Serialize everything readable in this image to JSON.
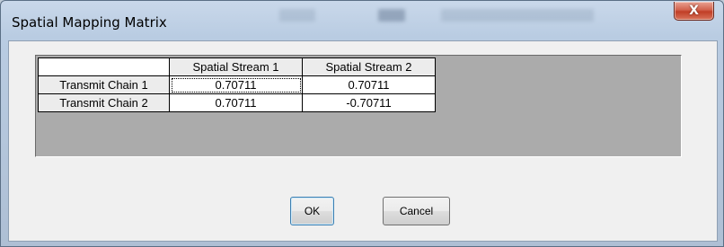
{
  "window": {
    "title": "Spatial Mapping Matrix",
    "close_label": "X"
  },
  "matrix": {
    "column_headers": [
      "Spatial Stream 1",
      "Spatial Stream 2"
    ],
    "rows": [
      {
        "label": "Transmit Chain 1",
        "values": [
          "0.70711",
          "0.70711"
        ]
      },
      {
        "label": "Transmit Chain 2",
        "values": [
          "0.70711",
          "-0.70711"
        ]
      }
    ]
  },
  "buttons": {
    "ok_label": "OK",
    "cancel_label": "Cancel"
  }
}
